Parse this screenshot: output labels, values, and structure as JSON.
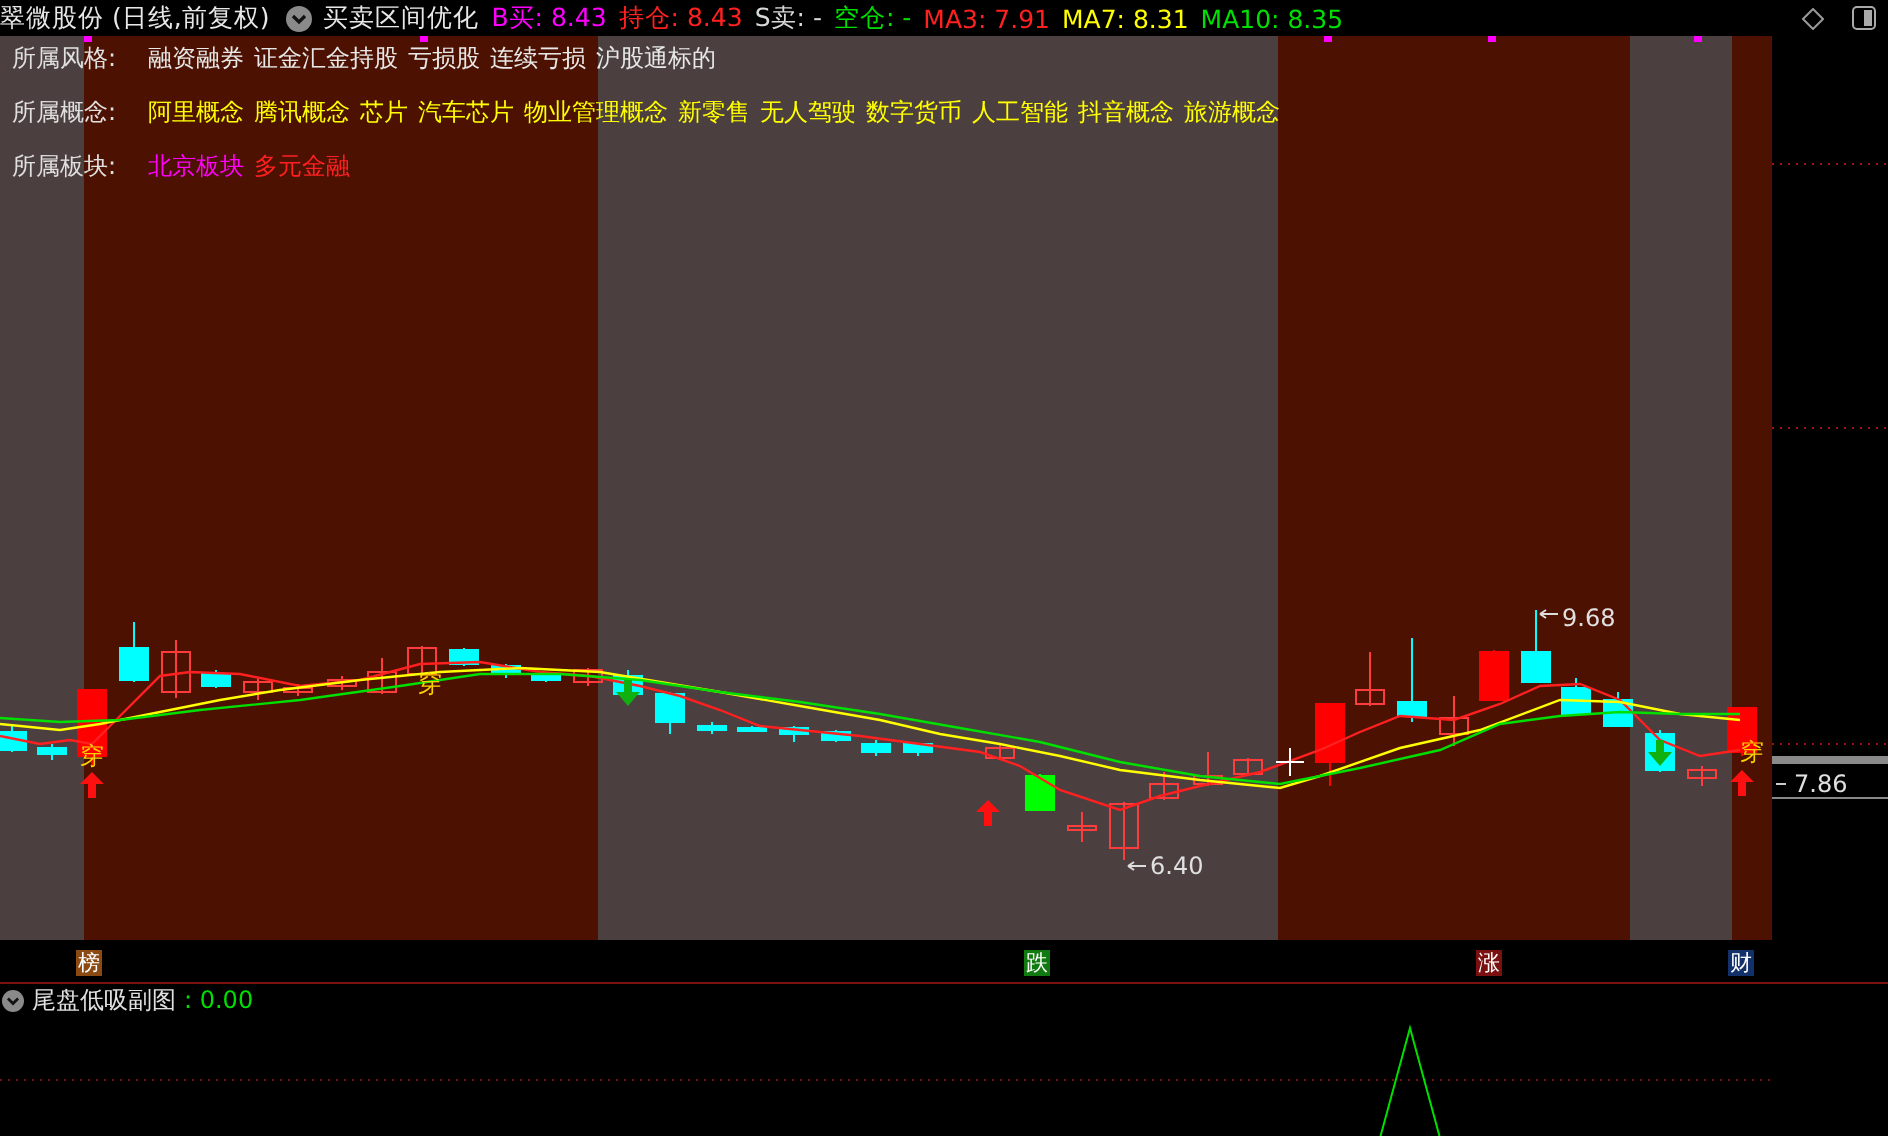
{
  "header": {
    "title": "翠微股份 (日线,前复权)",
    "indicator": "买卖区间优化",
    "values": [
      {
        "text": "B买: 8.43",
        "color": "#ff00ff"
      },
      {
        "text": "持仓: 8.43",
        "color": "#ff2020"
      },
      {
        "text": "S卖: -",
        "color": "#d8d8d8"
      },
      {
        "text": "空仓: -",
        "color": "#00e000"
      },
      {
        "text": "MA3: 7.91",
        "color": "#ff2020"
      },
      {
        "text": "MA7: 8.31",
        "color": "#ffff00"
      },
      {
        "text": "MA10: 8.35",
        "color": "#00e000"
      }
    ]
  },
  "info": [
    {
      "label": "所属风格:",
      "tags": [
        {
          "text": "融资融券",
          "color": "#e8e8e8"
        },
        {
          "text": "证金汇金持股",
          "color": "#e8e8e8"
        },
        {
          "text": "亏损股",
          "color": "#e8e8e8"
        },
        {
          "text": "连续亏损",
          "color": "#e8e8e8"
        },
        {
          "text": "沪股通标的",
          "color": "#e8e8e8"
        }
      ]
    },
    {
      "label": "所属概念:",
      "tags": [
        {
          "text": "阿里概念",
          "color": "#ffff00"
        },
        {
          "text": "腾讯概念",
          "color": "#ffff00"
        },
        {
          "text": "芯片",
          "color": "#ffff00"
        },
        {
          "text": "汽车芯片",
          "color": "#ffff00"
        },
        {
          "text": "物业管理概念",
          "color": "#ffff00"
        },
        {
          "text": "新零售",
          "color": "#ffff00"
        },
        {
          "text": "无人驾驶",
          "color": "#ffff00"
        },
        {
          "text": "数字货币",
          "color": "#ffff00"
        },
        {
          "text": "人工智能",
          "color": "#ffff00"
        },
        {
          "text": "抖音概念",
          "color": "#ffff00"
        },
        {
          "text": "旅游概念",
          "color": "#ffff00"
        }
      ]
    },
    {
      "label": "所属板块:",
      "tags": [
        {
          "text": "北京板块",
          "color": "#ff00ff"
        },
        {
          "text": "多元金融",
          "color": "#ff2020"
        }
      ]
    }
  ],
  "chart": {
    "markers": [
      "穿",
      "穿",
      "穿"
    ],
    "high_label": "9.68",
    "low_label": "6.40",
    "axis_label": "7.86"
  },
  "badges": [
    {
      "text": "榜",
      "color": "#8a4a12"
    },
    {
      "text": "跌",
      "color": "#107a10"
    },
    {
      "text": "涨",
      "color": "#7a1010"
    },
    {
      "text": "财",
      "color": "#12306a"
    }
  ],
  "sub_chart": {
    "title": "尾盘低吸副图",
    "value": ": 0.00"
  }
}
